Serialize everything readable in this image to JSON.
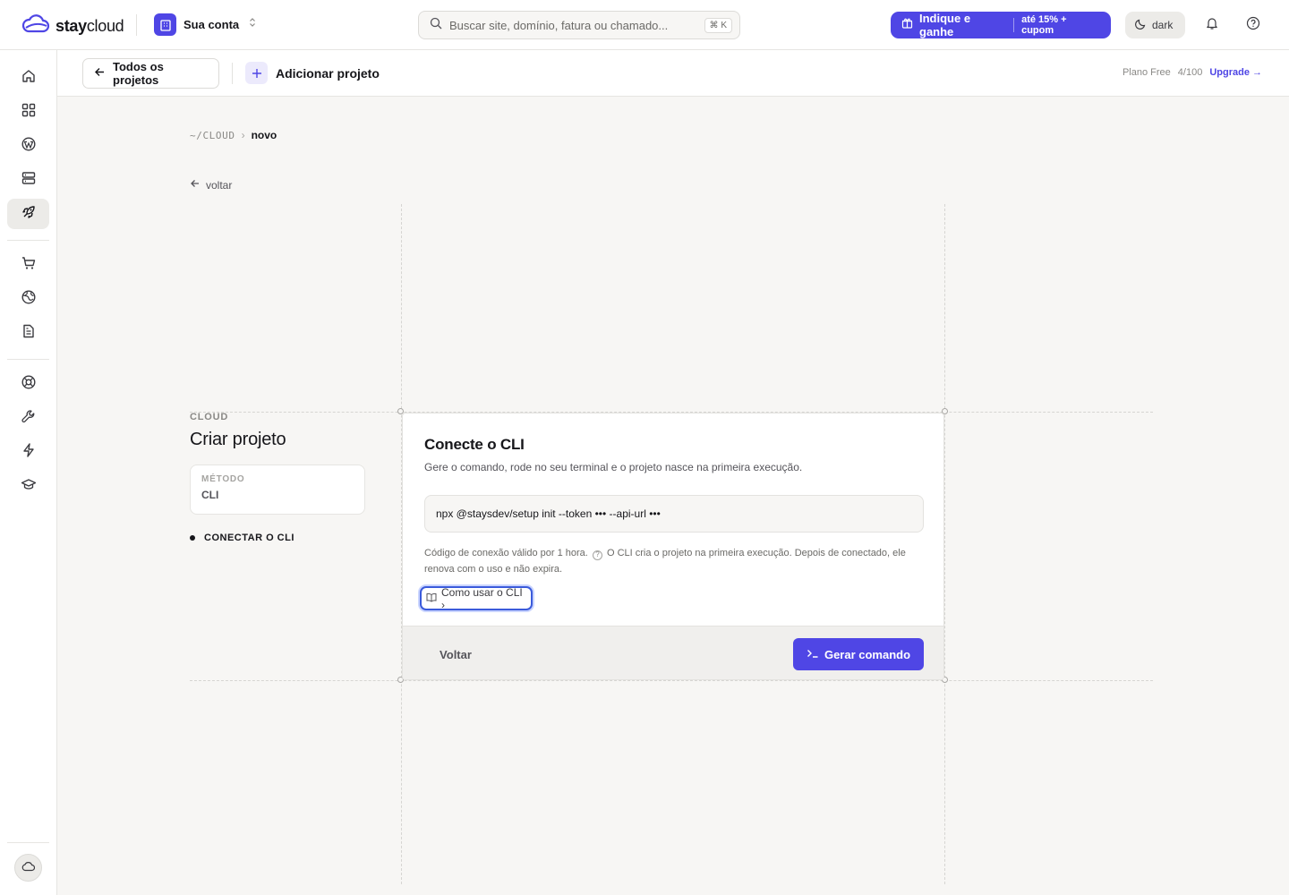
{
  "brand": {
    "name_bold": "stay",
    "name_rest": "cloud",
    "accent": "#4f46e5"
  },
  "account": {
    "name": "Sua conta"
  },
  "search": {
    "placeholder": "Buscar site, domínio, fatura ou chamado...",
    "shortcut": "⌘ K"
  },
  "referral": {
    "label": "Indique e ganhe",
    "sub": "até 15% + cupom"
  },
  "theme_toggle": {
    "label": "dark"
  },
  "sidebar": {
    "items": [
      {
        "name": "home",
        "icon": "home-icon"
      },
      {
        "name": "dashboard",
        "icon": "grid-icon"
      },
      {
        "name": "wordpress",
        "icon": "wordpress-icon"
      },
      {
        "name": "servers",
        "icon": "server-icon"
      },
      {
        "name": "deploy",
        "icon": "rocket-icon",
        "active": true
      },
      {
        "name": "store",
        "icon": "cart-icon"
      },
      {
        "name": "domains",
        "icon": "globe-icon"
      },
      {
        "name": "invoices",
        "icon": "document-icon"
      },
      {
        "name": "support",
        "icon": "lifebuoy-icon"
      },
      {
        "name": "tools",
        "icon": "wrench-icon"
      },
      {
        "name": "performance",
        "icon": "bolt-icon"
      },
      {
        "name": "academy",
        "icon": "graduation-cap-icon"
      }
    ]
  },
  "subheader": {
    "back_label": "Todos os projetos",
    "add_label": "Adicionar projeto",
    "plan_label": "Plano Free",
    "plan_usage": "4/100",
    "upgrade_label": "Upgrade →"
  },
  "breadcrumb": {
    "root": "~/CLOUD",
    "separator": "›",
    "current": "novo"
  },
  "back_link": {
    "label": "voltar"
  },
  "left": {
    "eyebrow": "CLOUD",
    "title": "Criar projeto",
    "method_label": "MÉTODO",
    "method_value": "CLI",
    "step_label": "CONECTAR O CLI"
  },
  "card": {
    "title": "Conecte o CLI",
    "subtitle": "Gere o comando, rode no seu terminal e o projeto nasce na primeira execução.",
    "command": "npx @staysdev/setup init --token ••• --api-url •••",
    "note_a": "Código de conexão válido por 1 hora.",
    "note_b": "O CLI cria o projeto na primeira execução. Depois de conectado, ele renova com o uso e não expira.",
    "help_link": "Como usar o CLI ›",
    "back_button": "Voltar",
    "generate_button": "Gerar comando"
  }
}
